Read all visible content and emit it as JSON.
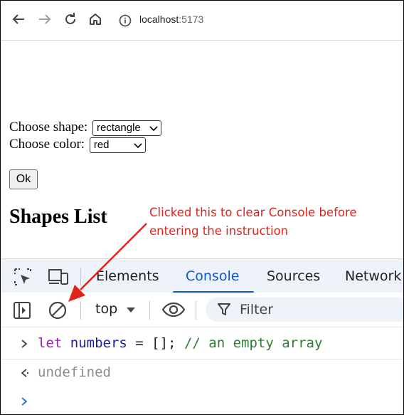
{
  "browser": {
    "url_host": "localhost",
    "url_port": ":5173"
  },
  "page": {
    "shape_label": "Choose shape:",
    "shape_selected": "rectangle",
    "color_label": "Choose color:",
    "color_selected": "red",
    "ok_label": "Ok",
    "heading": "Shapes List"
  },
  "annotation": {
    "line1": "Clicked this to clear Console before",
    "line2": "entering the instruction",
    "color": "#e0251b"
  },
  "devtools": {
    "tabs": [
      "Elements",
      "Console",
      "Sources",
      "Network"
    ],
    "active_tab": "Console",
    "context": "top",
    "filter_placeholder": "Filter",
    "console": {
      "input_keyword": "let",
      "input_var": "numbers",
      "input_op": " = [];",
      "input_comment": "// an empty array",
      "result": "undefined"
    },
    "accent_color": "#0b57d0"
  }
}
